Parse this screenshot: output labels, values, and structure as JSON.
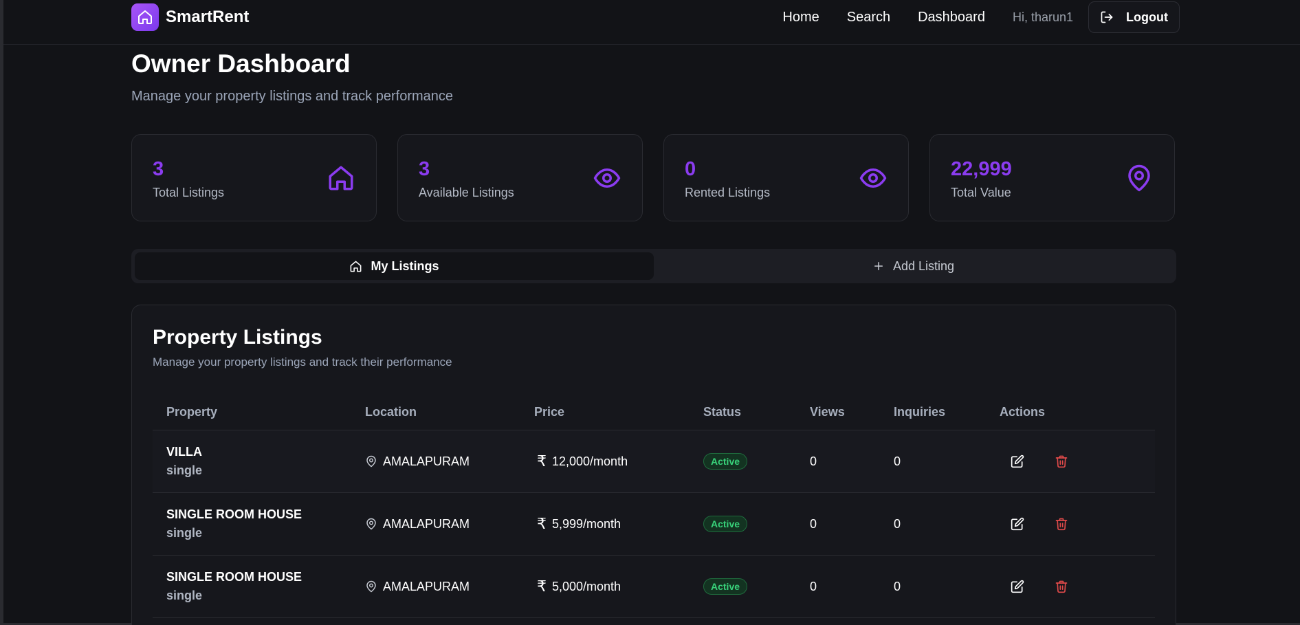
{
  "brand": {
    "name": "SmartRent",
    "logo_icon": "home-icon",
    "accent": "#8b3cf0"
  },
  "nav": {
    "links": [
      {
        "label": "Home"
      },
      {
        "label": "Search"
      },
      {
        "label": "Dashboard"
      }
    ],
    "greeting": "Hi, tharun1",
    "logout_label": "Logout",
    "logout_icon": "logout-icon"
  },
  "header": {
    "title": "Owner Dashboard",
    "subtitle": "Manage your property listings and track performance"
  },
  "stats": [
    {
      "value": "3",
      "label": "Total Listings",
      "icon": "home-icon"
    },
    {
      "value": "3",
      "label": "Available Listings",
      "icon": "eye-icon"
    },
    {
      "value": "0",
      "label": "Rented Listings",
      "icon": "eye-icon"
    },
    {
      "value": "22,999",
      "label": "Total Value",
      "icon": "map-pin-icon"
    }
  ],
  "tabs": [
    {
      "label": "My Listings",
      "icon": "home-icon",
      "active": true
    },
    {
      "label": "Add Listing",
      "icon": "plus-icon",
      "active": false
    }
  ],
  "listings": {
    "title": "Property Listings",
    "subtitle": "Manage your property listings and track their performance",
    "columns": [
      "Property",
      "Location",
      "Price",
      "Status",
      "Views",
      "Inquiries",
      "Actions"
    ],
    "rows": [
      {
        "name": "VILLA",
        "type": "single",
        "location": "AMALAPURAM",
        "currency": "₹",
        "price": "12,000/month",
        "status": "Active",
        "views": "0",
        "inquiries": "0"
      },
      {
        "name": "SINGLE ROOM HOUSE",
        "type": "single",
        "location": "AMALAPURAM",
        "currency": "₹",
        "price": "5,999/month",
        "status": "Active",
        "views": "0",
        "inquiries": "0"
      },
      {
        "name": "SINGLE ROOM HOUSE",
        "type": "single",
        "location": "AMALAPURAM",
        "currency": "₹",
        "price": "5,000/month",
        "status": "Active",
        "views": "0",
        "inquiries": "0"
      }
    ]
  }
}
